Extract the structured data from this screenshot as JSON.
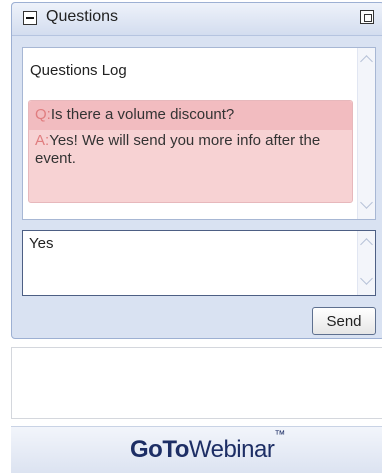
{
  "panel": {
    "title": "Questions"
  },
  "log": {
    "title": "Questions Log",
    "entries": [
      {
        "prefix": "Q:",
        "text": "Is there a volume discount?"
      },
      {
        "prefix": "A:",
        "text": "Yes! We will send you more info after the event."
      }
    ]
  },
  "input": {
    "value": "Yes"
  },
  "actions": {
    "send": "Send"
  },
  "footer": {
    "brand_goto": "GoTo",
    "brand_webinar": "Webinar",
    "brand_tm": "™"
  },
  "colors": {
    "panel_bg": "#d9e2f2",
    "qa_bg": "#f7d2d3",
    "prefix": "#e07d7f",
    "brand": "#1d2e65"
  },
  "icons": {
    "collapse": "minus-icon",
    "popout": "popout-icon",
    "scroll_up": "chevron-up-icon",
    "scroll_down": "chevron-down-icon"
  }
}
